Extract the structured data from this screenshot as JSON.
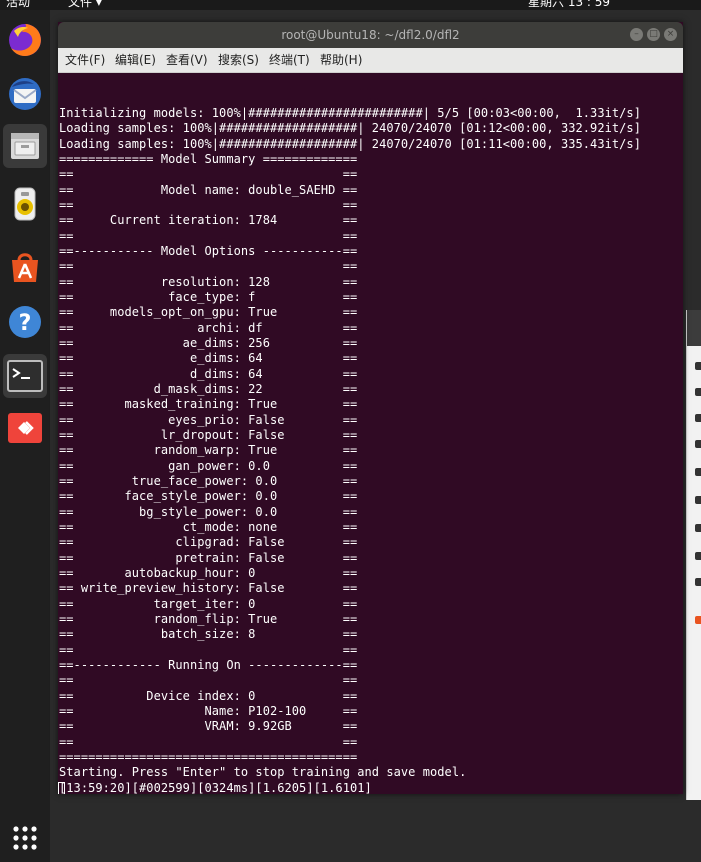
{
  "topbar": {
    "activities": "活动",
    "app_menu": "文件 ▾",
    "clock": "星期六 13 : 59"
  },
  "dock": {
    "apps": [
      {
        "name": "firefox-icon",
        "color": "#e66000"
      },
      {
        "name": "thunderbird-icon",
        "color": "#2f6cc4"
      },
      {
        "name": "files-icon",
        "color": "#d9d9d9"
      },
      {
        "name": "rhythmbox-icon",
        "color": "#e8c000"
      },
      {
        "name": "software-center-icon",
        "color": "#e95420"
      },
      {
        "name": "help-icon",
        "color": "#3f86d6"
      },
      {
        "name": "terminal-icon",
        "color": "#2e2e2e"
      },
      {
        "name": "anydesk-icon",
        "color": "#ef443b"
      }
    ],
    "show_apps": "⋮⋮⋮"
  },
  "window": {
    "title": "root@Ubuntu18: ~/dfl2.0/dfl2",
    "menu": [
      "文件(F)",
      "编辑(E)",
      "查看(V)",
      "搜索(S)",
      "终端(T)",
      "帮助(H)"
    ],
    "minimize": "–",
    "maximize": "□",
    "close": "×"
  },
  "terminal": {
    "lines": [
      "Initializing models: 100%|########################| 5/5 [00:03<00:00,  1.33it/s]",
      "Loading samples: 100%|###################| 24070/24070 [01:12<00:00, 332.92it/s]",
      "Loading samples: 100%|###################| 24070/24070 [01:11<00:00, 335.43it/s]",
      "============= Model Summary =============",
      "==                                     ==",
      "==            Model name: double_SAEHD ==",
      "==                                     ==",
      "==     Current iteration: 1784         ==",
      "==                                     ==",
      "==----------- Model Options -----------==",
      "==                                     ==",
      "==            resolution: 128          ==",
      "==             face_type: f            ==",
      "==     models_opt_on_gpu: True         ==",
      "==                 archi: df           ==",
      "==               ae_dims: 256          ==",
      "==                e_dims: 64           ==",
      "==                d_dims: 64           ==",
      "==           d_mask_dims: 22           ==",
      "==       masked_training: True         ==",
      "==             eyes_prio: False        ==",
      "==            lr_dropout: False        ==",
      "==           random_warp: True         ==",
      "==             gan_power: 0.0          ==",
      "==        true_face_power: 0.0         ==",
      "==       face_style_power: 0.0         ==",
      "==         bg_style_power: 0.0         ==",
      "==               ct_mode: none         ==",
      "==              clipgrad: False        ==",
      "==              pretrain: False        ==",
      "==       autobackup_hour: 0            ==",
      "== write_preview_history: False        ==",
      "==           target_iter: 0            ==",
      "==           random_flip: True         ==",
      "==            batch_size: 8            ==",
      "==                                     ==",
      "==------------ Running On -------------==",
      "==                                     ==",
      "==          Device index: 0            ==",
      "==                  Name: P102-100     ==",
      "==                  VRAM: 9.92GB       ==",
      "==                                     ==",
      "=========================================",
      "Starting. Press \"Enter\" to stop training and save model.",
      "[13:59:20][#002599][0324ms][1.6205][1.6101]"
    ]
  }
}
